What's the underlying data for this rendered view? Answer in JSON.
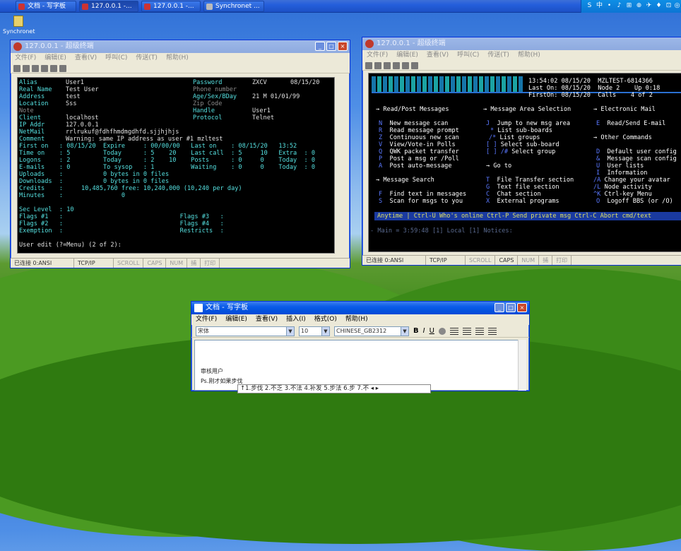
{
  "taskbar": {
    "buttons": [
      "文档 - 写字板",
      "127.0.0.1 -...",
      "127.0.0.1 -...",
      "Synchronet ..."
    ],
    "tray": [
      "S",
      "中",
      "•",
      "♪",
      "⊞",
      "⊕",
      "✈",
      "♦",
      "⊡",
      "◎"
    ]
  },
  "desktop_icon": {
    "label": "Synchronet"
  },
  "term1": {
    "title": "127.0.0.1 - 超级终端",
    "menus": [
      "文件(F)",
      "编辑(E)",
      "查看(V)",
      "呼叫(C)",
      "传送(T)",
      "帮助(H)"
    ],
    "left_col": [
      [
        "Alias",
        "User1"
      ],
      [
        "Real Name",
        "Test User"
      ],
      [
        "Address",
        "test"
      ],
      [
        "Location",
        "Sss"
      ],
      [
        "Note",
        ""
      ],
      [
        "Client",
        "localhost"
      ],
      [
        "IP Addr",
        "127.0.0.1"
      ],
      [
        "NetMail",
        "rrlrukuf@fdhfhmdmgdhfd.sjjhjhjs"
      ],
      [
        "Comment",
        "Warning: same IP address as user #1 mzltest"
      ]
    ],
    "right_col": [
      [
        "Password",
        "ZXCV",
        "08/15/20"
      ],
      [
        "Phone number",
        ""
      ],
      [
        "Age/Sex/BDay",
        "21 M 01/01/99"
      ],
      [
        "Zip Code",
        ""
      ],
      [
        "Handle",
        "User1"
      ],
      [
        "Protocol",
        "Telnet"
      ]
    ],
    "stats": [
      "First on   : 08/15/20  Expire     : 00/00/00   Last on    : 08/15/20   13:52",
      "Time on    : 5         Today      : 5    20    Last call  : 5     10   Extra  : 0",
      "Logons     : 2         Today      : 2    10    Posts      : 0     0    Today  : 0",
      "E-mails    : 0         To sysop   : 1          Waiting    : 0     0    Today  : 0",
      "Uploads    :           0 bytes in 0 files",
      "Downloads  :           0 bytes in 0 files",
      "Credits    :     10,485,760 free: 10,240,000 (10,240 per day)",
      "Minutes    :                0"
    ],
    "sec": [
      "Sec Level  : 10",
      "Flags #1   :                                Flags #3   :",
      "Flags #2   :                                Flags #4   :",
      "Exemption  :                                Restricts  :"
    ],
    "prompt": "User edit (?=Menu) (2 of 2):",
    "status": [
      "已连接 0:ANSI",
      "TCP/IP",
      "SCROLL",
      "CAPS",
      "NUM",
      "捕",
      "打印"
    ]
  },
  "term2": {
    "title": "127.0.0.1 - 超级终端",
    "menus": [
      "文件(F)",
      "编辑(E)",
      "查看(V)",
      "呼叫(C)",
      "传送(T)",
      "帮助(H)"
    ],
    "info": [
      "13:54:02 08/15/20  MZLTEST-6814366",
      "Last On: 08/15/20  Node 2    Up 0:18",
      "FirstOn: 08/15/20  Calls    4 of 2"
    ],
    "sections": [
      "Read/Post Messages",
      "Message Area Selection",
      "Electronic Mail",
      "Other Commands",
      "Go to",
      "Message Search"
    ],
    "col1": [
      [
        "N",
        "New message scan"
      ],
      [
        "R",
        "Read message prompt"
      ],
      [
        "Z",
        "Continuous new scan"
      ],
      [
        "V",
        "View/Vote-in Polls"
      ],
      [
        "Q",
        "QWK packet transfer"
      ],
      [
        "P",
        "Post a msg or /Poll"
      ],
      [
        "A",
        "Post auto-message"
      ]
    ],
    "col2": [
      [
        "J",
        "Jump to new msg area"
      ],
      [
        "*",
        "List sub-boards"
      ],
      [
        "/*",
        "List groups"
      ],
      [
        "[ ]",
        "Select sub-board"
      ],
      [
        "[ ] /#",
        "Select group"
      ]
    ],
    "col3": [
      [
        "E",
        "Read/Send E-mail"
      ]
    ],
    "col3b": [
      [
        "D",
        "Default user config"
      ],
      [
        "&",
        "Message scan config"
      ],
      [
        "U",
        "User lists"
      ],
      [
        "I",
        "Information"
      ],
      [
        "/A",
        "Change your avatar"
      ],
      [
        "/L",
        "Node activity"
      ],
      [
        "^K",
        "Ctrl-key Menu"
      ],
      [
        "O",
        "Logoff BBS (or /O)"
      ]
    ],
    "search": [
      [
        "F",
        "Find text in messages"
      ],
      [
        "S",
        "Scan for msgs to you"
      ]
    ],
    "goto": [
      [
        "T",
        "File Transfer section"
      ],
      [
        "G",
        "Text file section"
      ],
      [
        "C",
        "Chat section"
      ],
      [
        "X",
        "External programs"
      ]
    ],
    "hotbar": "Anytime | Ctrl-U Who's online Ctrl-P Send private msg Ctrl-C Abort cmd/text",
    "prompt": "- Main = 3:59:48 [1] Local [1] Notices:",
    "status": [
      "已连接 0:ANSI",
      "TCP/IP",
      "SCROLL",
      "CAPS",
      "NUM",
      "捕",
      "打印"
    ]
  },
  "wordpad": {
    "title": "文档 - 写字板",
    "menus": [
      "文件(F)",
      "编辑(E)",
      "查看(V)",
      "插入(I)",
      "格式(O)",
      "帮助(H)"
    ],
    "font": "宋体",
    "size": "10",
    "script": "CHINESE_GB2312",
    "lines": [
      "审核用户",
      "Ps.刚才如果步伐"
    ],
    "ime": "↑1.步伐  2.不乏  3.不法  4.补发  5.步法  6.步  7.不  ◂ ▸"
  }
}
